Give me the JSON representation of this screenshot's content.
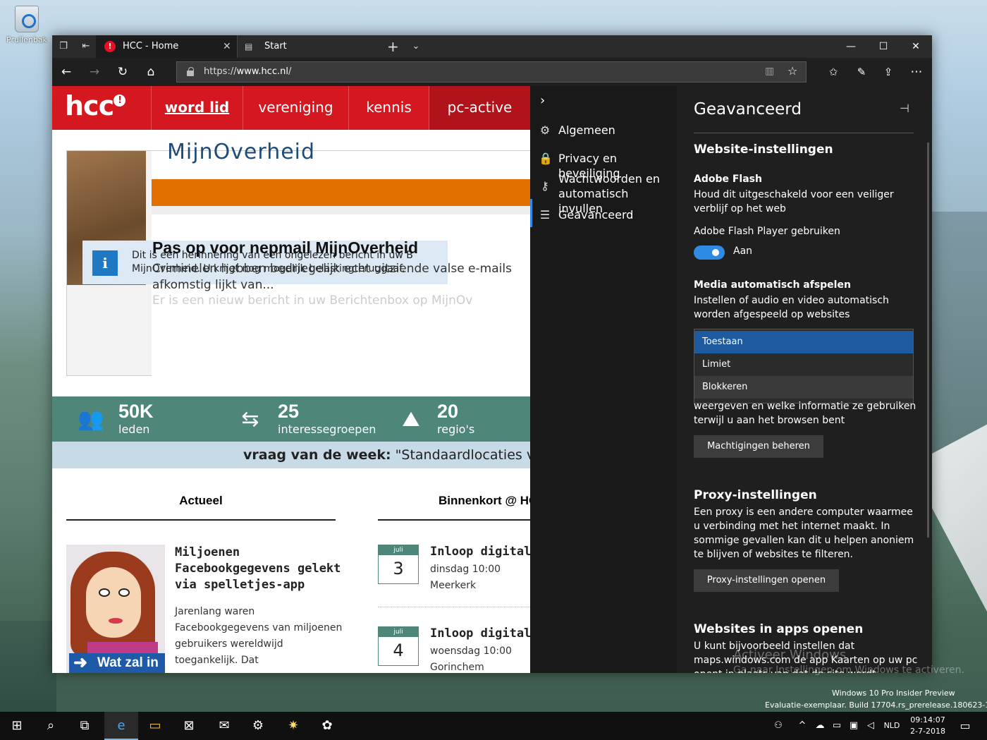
{
  "desktop": {
    "recycle_bin_label": "Prullenbak"
  },
  "browser": {
    "tabs": [
      {
        "title": "HCC - Home"
      },
      {
        "title": "Start"
      }
    ],
    "url_scheme": "https://",
    "url_host": "www.hcc.nl",
    "url_path": "/"
  },
  "site": {
    "logo": "hcc",
    "nav": [
      "word lid",
      "vereniging",
      "kennis",
      "pc-active"
    ],
    "banner": {
      "mijnoverheid": "MijnOverheid",
      "info_line1": "Dit is een herinnering van een ongelezen bericht in uw B",
      "info_line2": "MijnOverheid. U krijgt nog mogelijk belastingteruggaaf.",
      "title": "Pas op voor nepmail MijnOverheid",
      "body_line1": "Criminelen hebben bedriegelijk echt uitziende valse e-mails",
      "body_line2": "afkomstig lijkt van...",
      "faded": "Er is een nieuw bericht in uw Berichtenbox op MijnOv"
    },
    "stats": [
      {
        "num": "50K",
        "label": "leden"
      },
      {
        "num": "25",
        "label": "interessegroepen"
      },
      {
        "num": "20",
        "label": "regio's"
      }
    ],
    "vraag_label": "vraag van de week:",
    "vraag_text": " \"Standaardlocaties voor bes",
    "col_actueel": "Actueel",
    "col_binnenkort": "Binnenkort @ HCC",
    "article": {
      "title": "Miljoenen Facebookgegevens gelekt via spelletjes-app",
      "body": "Jarenlang waren Facebookgegevens van miljoenen gebruikers wereldwijd toegankelijk. Dat",
      "banner": "Wat zal in"
    },
    "events": [
      {
        "month": "juli",
        "day": "3",
        "title": "Inloop digitale h",
        "when": "dinsdag 10:00",
        "where": "Meerkerk"
      },
      {
        "month": "juli",
        "day": "4",
        "title": "Inloop digitale h",
        "when": "woensdag 10:00",
        "where": "Gorinchem"
      }
    ]
  },
  "hub": {
    "nav": [
      {
        "label": "Algemeen",
        "icon": "gear-icon"
      },
      {
        "label": "Privacy en beveiliging",
        "icon": "lock-icon"
      },
      {
        "label": "Wachtwoorden en automatisch invullen",
        "icon": "key-icon"
      },
      {
        "label": "Geavanceerd",
        "icon": "sliders-icon"
      }
    ],
    "title": "Geavanceerd",
    "section_website": "Website-instellingen",
    "flash_title": "Adobe Flash",
    "flash_desc": "Houd dit uitgeschakeld voor een veiliger verblijf op het web",
    "flash_use": "Adobe Flash Player gebruiken",
    "flash_state": "Aan",
    "media_title": "Media automatisch afspelen",
    "media_desc": "Instellen of audio en video automatisch worden afgespeeld op websites",
    "media_options": [
      "Toestaan",
      "Limiet",
      "Blokkeren"
    ],
    "media_selected": "Toestaan",
    "perm_text_line1": "weergeven en welke informatie ze gebruiken",
    "perm_text_line2": "terwijl u aan het browsen bent",
    "perm_button": "Machtigingen beheren",
    "proxy_title": "Proxy-instellingen",
    "proxy_desc": "Een proxy is een andere computer waarmee u verbinding met het internet maakt. In sommige gevallen kan dit u helpen anoniem te blijven of websites te filteren.",
    "proxy_button": "Proxy-instellingen openen",
    "apps_title": "Websites in apps openen",
    "apps_desc": "U kunt bijvoorbeeld instellen dat maps.windows.com de app Kaarten op uw pc opent in plaats van dat de site wordt"
  },
  "os": {
    "watermark1": "Activeer Windows",
    "watermark2": "Ga naar Instellingen om Windows te activeren.",
    "eval1": "Windows 10 Pro Insider Preview",
    "eval2": "Evaluatie-exemplaar. Build 17704.rs_prerelease.180623-1611",
    "lang": "NLD",
    "time": "09:14:07",
    "date": "2-7-2018"
  }
}
